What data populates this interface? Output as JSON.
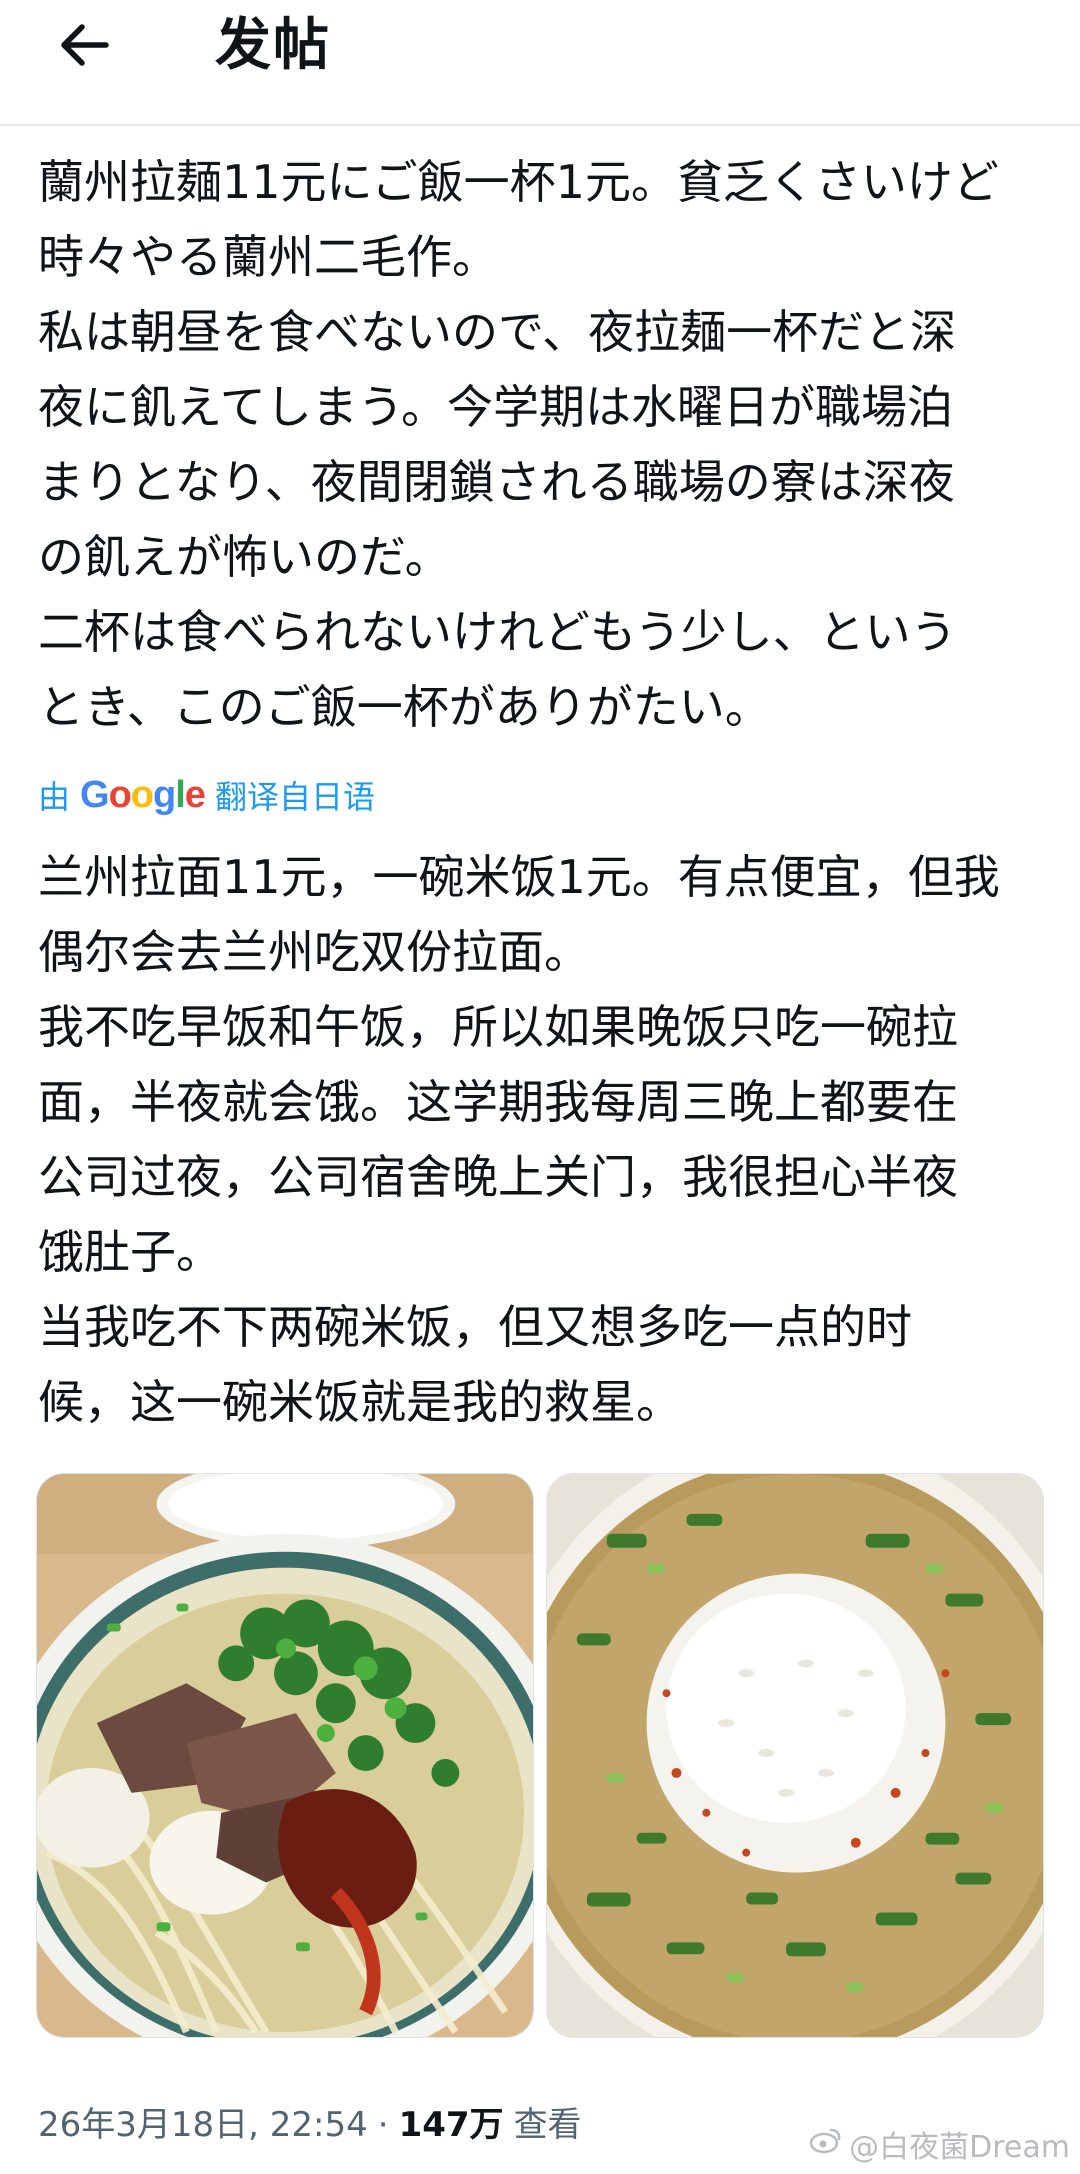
{
  "header": {
    "title": "发帖",
    "back_icon": "arrow-left-icon"
  },
  "post": {
    "original_text": "蘭州拉麺11元にご飯一杯1元。貧乏くさいけど\n時々やる蘭州二毛作。\n私は朝昼を食べないので、夜拉麺一杯だと深\n夜に飢えてしまう。今学期は水曜日が職場泊\nまりとなり、夜間閉鎖される職場の寮は深夜\nの飢えが怖いのだ。\n二杯は食べられないけれどもう少し、という\nとき、このご飯一杯がありがたい。",
    "translation": {
      "prefix": "由",
      "provider": "Google",
      "suffix": "翻译自日语"
    },
    "translated_text": "兰州拉面11元，一碗米饭1元。有点便宜，但我\n偶尔会去兰州吃双份拉面。\n我不吃早饭和午饭，所以如果晚饭只吃一碗拉\n面，半夜就会饿。这学期我每周三晚上都要在\n公司过夜，公司宿舍晚上关门，我很担心半夜\n饿肚子。\n当我吃不下两碗米饭，但又想多吃一点的时\n候，这一碗米饭就是我的救星。",
    "photos": [
      {
        "name": "lanzhou-beef-noodles-photo"
      },
      {
        "name": "rice-in-soup-photo"
      }
    ],
    "meta": {
      "timestamp": "26年3月18日, 22:54",
      "separator": "·",
      "views_count": "147万",
      "views_label": "查看"
    }
  },
  "watermark": {
    "text": "@白夜菌Dream",
    "icon": "weibo-icon"
  },
  "colors": {
    "link": "#1d9bf0",
    "text": "#0f1419",
    "muted": "#536471",
    "divider": "#e6e9ec"
  }
}
